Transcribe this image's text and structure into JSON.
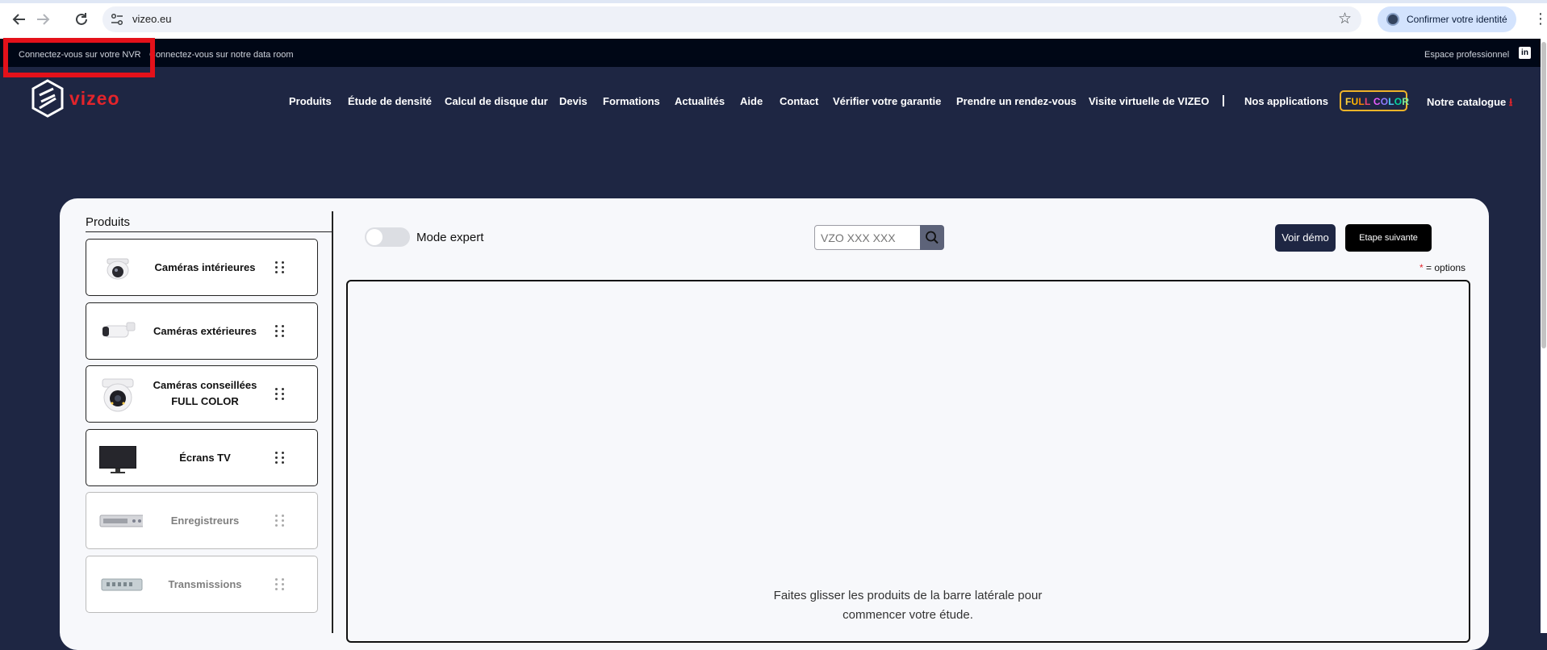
{
  "browser": {
    "url": "vizeo.eu",
    "identity_button": "Confirmer votre identité",
    "icons": {
      "back": "arrow-left-icon",
      "forward": "arrow-right-icon",
      "reload": "reload-icon",
      "site_info": "tune-icon",
      "bookmark": "star-icon",
      "menu": "kebab-icon"
    }
  },
  "topbar": {
    "link_nvr": "Connectez-vous sur votre NVR",
    "link_dataroom": "Connectez-vous sur notre data room",
    "link_pro": "Espace professionnel",
    "linkedin": "in",
    "highlight_color": "#e4111a"
  },
  "header": {
    "logo_text": "vizeo",
    "nav": [
      "Produits",
      "Étude de densité",
      "Calcul de disque dur",
      "Devis",
      "Formations",
      "Actualités",
      "Aide",
      "Contact",
      "Vérifier votre garantie",
      "Prendre un rendez-vous",
      "Visite virtuelle de VIZEO",
      "Nos applications",
      "FULL COLOR",
      "Notre catalogue"
    ],
    "brand_color": "#e3242b",
    "nav_background": "#1e2643"
  },
  "sidebar": {
    "title": "Produits",
    "items": [
      {
        "label": "Caméras intérieures",
        "icon": "dome-camera-icon"
      },
      {
        "label": "Caméras extérieures",
        "icon": "bullet-camera-icon"
      },
      {
        "label_line1": "Caméras conseillées",
        "label_line2": "FULL COLOR",
        "icon": "turret-camera-icon"
      },
      {
        "label": "Écrans TV",
        "icon": "tv-screen-icon"
      },
      {
        "label": "Enregistreurs",
        "icon": "nvr-recorder-icon"
      },
      {
        "label": "Transmissions",
        "icon": "network-switch-icon"
      }
    ]
  },
  "toolbar": {
    "expert_mode_label": "Mode expert",
    "expert_mode_on": false,
    "search_placeholder": "VZO XXX XXX",
    "demo_button": "Voir démo",
    "next_button": "Etape suivante",
    "options_star": "*",
    "options_note": "= options"
  },
  "dropzone": {
    "message_line1": "Faites glisser les produits de la barre latérale pour",
    "message_line2": "commencer votre étude."
  }
}
